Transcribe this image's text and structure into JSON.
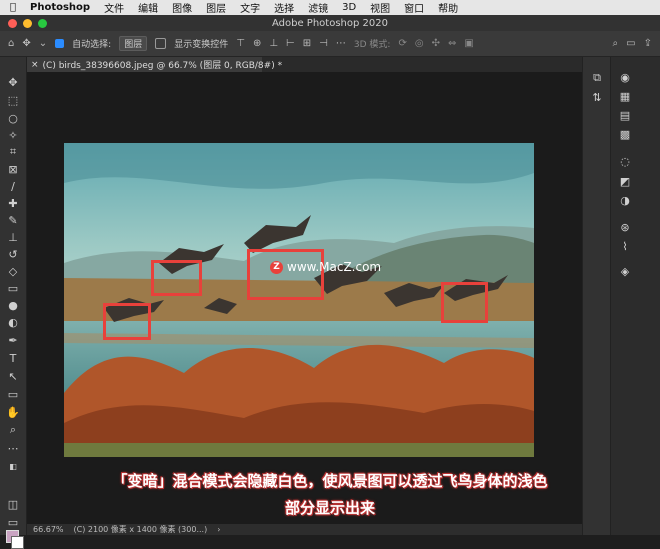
{
  "menubar": {
    "app": "Photoshop",
    "items": [
      "文件",
      "编辑",
      "图像",
      "图层",
      "文字",
      "选择",
      "滤镜",
      "3D",
      "视图",
      "窗口",
      "帮助"
    ]
  },
  "window": {
    "title": "Adobe Photoshop 2020"
  },
  "options": {
    "auto_select_label": "自动选择:",
    "auto_select_value": "图层",
    "show_transform_label": "显示变换控件",
    "mode_3d_label": "3D 模式:"
  },
  "document": {
    "tab_title": "(C) birds_38396608.jpeg @ 66.7% (图层 0, RGB/8#) *"
  },
  "watermark": {
    "text": "www.MacZ.com",
    "logo": "Z"
  },
  "caption": {
    "line1": "「变暗」混合模式会隐藏白色，使风景图可以透过飞鸟身体的浅色",
    "line2": "部分显示出来"
  },
  "status": {
    "zoom": "66.67%",
    "info": "(C) 2100 像素 x 1400 像素 (300...)"
  },
  "colors": {
    "foreground": "#c9a3c2",
    "background": "#ffffff",
    "highlight": "#e8413b"
  }
}
